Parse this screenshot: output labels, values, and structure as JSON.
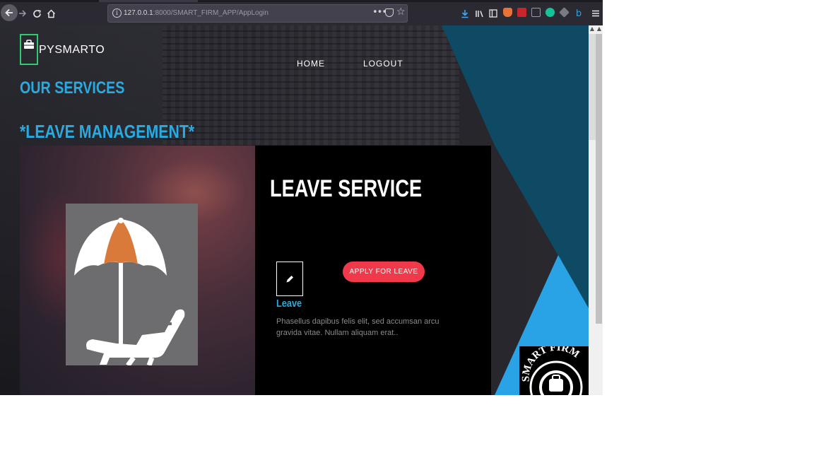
{
  "browser": {
    "url_host": "127.0.0.1",
    "url_rest": ":8000/SMART_FIRM_APP/AppLogin",
    "page_actions": "•••"
  },
  "site": {
    "brand": "PYSMARTO",
    "nav": {
      "home": "HOME",
      "logout": "LOGOUT"
    },
    "services_heading": "OUR SERVICES",
    "section_heading": "*LEAVE MANAGEMENT*"
  },
  "service_card": {
    "title": "LEAVE SERVICE",
    "button_label": "APPLY FOR LEAVE",
    "item_label": "Leave",
    "description": "Phasellus dapibus felis elit, sed accumsan arcu gravida vitae. Nullam aliquam erat.."
  },
  "footer_logo": {
    "text": "SMART FIRM"
  },
  "colors": {
    "accent_blue": "#29abe2",
    "button_red": "#f0394a",
    "logo_green": "#2ecc71",
    "teal_panel": "#0e4a63",
    "bright_blue": "#2aa3e6"
  },
  "icons": {
    "logo": "briefcase-icon",
    "card": "pencil-icon",
    "illustration": "beach-umbrella-lounger-icon"
  }
}
